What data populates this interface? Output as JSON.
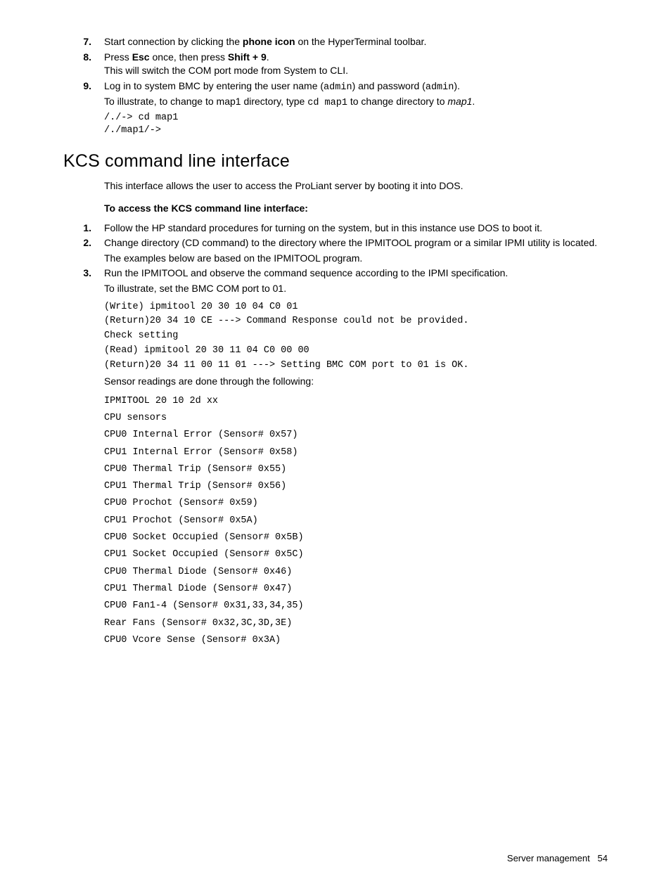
{
  "steps_top": [
    {
      "num": "7.",
      "pre": "Start connection by clicking the ",
      "bold": "phone icon",
      "post": " on the HyperTerminal toolbar."
    }
  ],
  "step8": {
    "num": "8.",
    "t1": "Press ",
    "b1": "Esc",
    "t2": " once, then press ",
    "b2": "Shift + 9",
    "t3": ".",
    "line2": "This will switch the COM port mode from System to CLI."
  },
  "step9": {
    "num": "9.",
    "t1": "Log in to system BMC by entering the user name (",
    "m1": "admin",
    "t2": ") and password (",
    "m2": "admin",
    "t3": ").",
    "line2a": "To illustrate, to change to map1 directory, type ",
    "line2m": "cd map1",
    "line2b": " to change directory to ",
    "line2i": "map1",
    "line2c": ".",
    "code1": "/./-> cd map1",
    "code2": "/./map1/->"
  },
  "section_title": "KCS command line interface",
  "intro": "This interface allows the user to access the ProLiant server by booting it into DOS.",
  "subhead": "To access the KCS command line interface:",
  "kcs1": {
    "num": "1.",
    "text": "Follow the HP standard procedures for turning on the system, but in this instance use DOS to boot it."
  },
  "kcs2": {
    "num": "2.",
    "text": "Change directory (CD command) to the directory where the IPMITOOL program or a similar IPMI utility is located.",
    "line2": "The examples below are based on the IPMITOOL program."
  },
  "kcs3": {
    "num": "3.",
    "text": "Run the IPMITOOL and observe the command sequence according to the IPMI specification.",
    "line2": "To illustrate, set the BMC COM port to 01."
  },
  "codeblock": [
    "(Write) ipmitool 20 30 10 04 C0 01",
    "(Return)20 34 10 CE ---> Command Response could not be provided.",
    "Check setting",
    "(Read) ipmitool 20 30 11 04 C0 00 00",
    "(Return)20 34 11 00 11 01 ---> Setting BMC COM port to 01 is OK."
  ],
  "sensor_intro": "Sensor readings are done through the following:",
  "sensors": [
    "IPMITOOL 20 10 2d xx",
    "CPU sensors",
    "CPU0 Internal Error (Sensor# 0x57)",
    "CPU1 Internal Error (Sensor# 0x58)",
    "CPU0 Thermal Trip (Sensor# 0x55)",
    "CPU1 Thermal Trip (Sensor# 0x56)",
    "CPU0 Prochot (Sensor# 0x59)",
    "CPU1 Prochot (Sensor# 0x5A)",
    "CPU0 Socket Occupied (Sensor# 0x5B)",
    "CPU1 Socket Occupied (Sensor# 0x5C)",
    "CPU0 Thermal Diode (Sensor# 0x46)",
    "CPU1 Thermal Diode (Sensor# 0x47)",
    "CPU0 Fan1-4 (Sensor# 0x31,33,34,35)",
    "Rear Fans (Sensor# 0x32,3C,3D,3E)",
    "CPU0 Vcore Sense (Sensor# 0x3A)"
  ],
  "footer_label": "Server management",
  "footer_page": "54"
}
